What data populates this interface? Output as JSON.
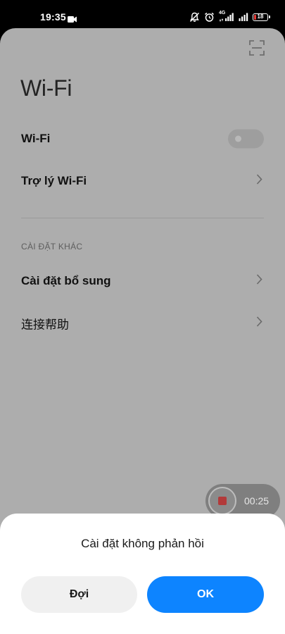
{
  "status_bar": {
    "time": "19:35",
    "network_label": "4G",
    "battery_level": 18,
    "battery_text": "18",
    "icons": [
      "video-camera-icon",
      "muted-notification-icon",
      "alarm-icon",
      "signal-4g-icon",
      "signal-bars-icon",
      "battery-icon"
    ]
  },
  "header": {
    "title": "Wi-Fi",
    "scan_icon": "qr-scan-icon"
  },
  "settings": {
    "wifi_label": "Wi-Fi",
    "wifi_enabled": false,
    "wifi_assistant_label": "Trợ lý Wi-Fi",
    "section_header": "CÀI ĐẶT KHÁC",
    "additional_settings_label": "Cài đặt bổ sung",
    "connection_help_label": "连接帮助"
  },
  "recorder": {
    "elapsed": "00:25"
  },
  "dialog": {
    "message": "Cài đặt không phản hồi",
    "wait_label": "Đợi",
    "ok_label": "OK"
  },
  "colors": {
    "primary_button": "#0d84ff",
    "secondary_button": "#f0f0f0",
    "dim_background": "#adadad",
    "battery_low": "#e53935"
  }
}
